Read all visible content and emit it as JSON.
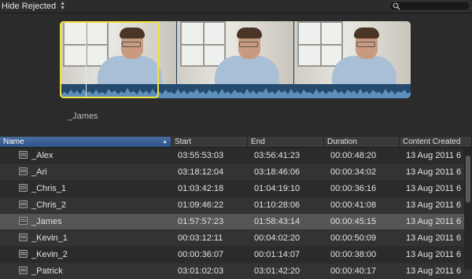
{
  "toolbar": {
    "filter_label": "Hide Rejected",
    "search_value": ""
  },
  "filmstrip": {
    "clip_name": "_James"
  },
  "table": {
    "columns": [
      "Name",
      "Start",
      "End",
      "Duration",
      "Content Created"
    ],
    "sorted_column": "Name",
    "rows": [
      {
        "name": "_Alex",
        "start": "03:55:53:03",
        "end": "03:56:41:23",
        "duration": "00:00:48:20",
        "created": "13 Aug 2011 6"
      },
      {
        "name": "_Ari",
        "start": "03:18:12:04",
        "end": "03:18:46:06",
        "duration": "00:00:34:02",
        "created": "13 Aug 2011 6"
      },
      {
        "name": "_Chris_1",
        "start": "01:03:42:18",
        "end": "01:04:19:10",
        "duration": "00:00:36:16",
        "created": "13 Aug 2011 6"
      },
      {
        "name": "_Chris_2",
        "start": "01:09:46:22",
        "end": "01:10:28:06",
        "duration": "00:00:41:08",
        "created": "13 Aug 2011 6"
      },
      {
        "name": "_James",
        "start": "01:57:57:23",
        "end": "01:58:43:14",
        "duration": "00:00:45:15",
        "created": "13 Aug 2011 6"
      },
      {
        "name": "_Kevin_1",
        "start": "00:03:12:11",
        "end": "00:04:02:20",
        "duration": "00:00:50:09",
        "created": "13 Aug 2011 6"
      },
      {
        "name": "_Kevin_2",
        "start": "00:00:36:07",
        "end": "00:01:14:07",
        "duration": "00:00:38:00",
        "created": "13 Aug 2011 6"
      },
      {
        "name": "_Patrick",
        "start": "03:01:02:03",
        "end": "03:01:42:20",
        "duration": "00:00:40:17",
        "created": "13 Aug 2011 6"
      }
    ],
    "selected_index": 4
  },
  "colors": {
    "selection_border": "#f2e23a",
    "sorted_header": "#3d6196",
    "waveform": "#244a6d"
  }
}
